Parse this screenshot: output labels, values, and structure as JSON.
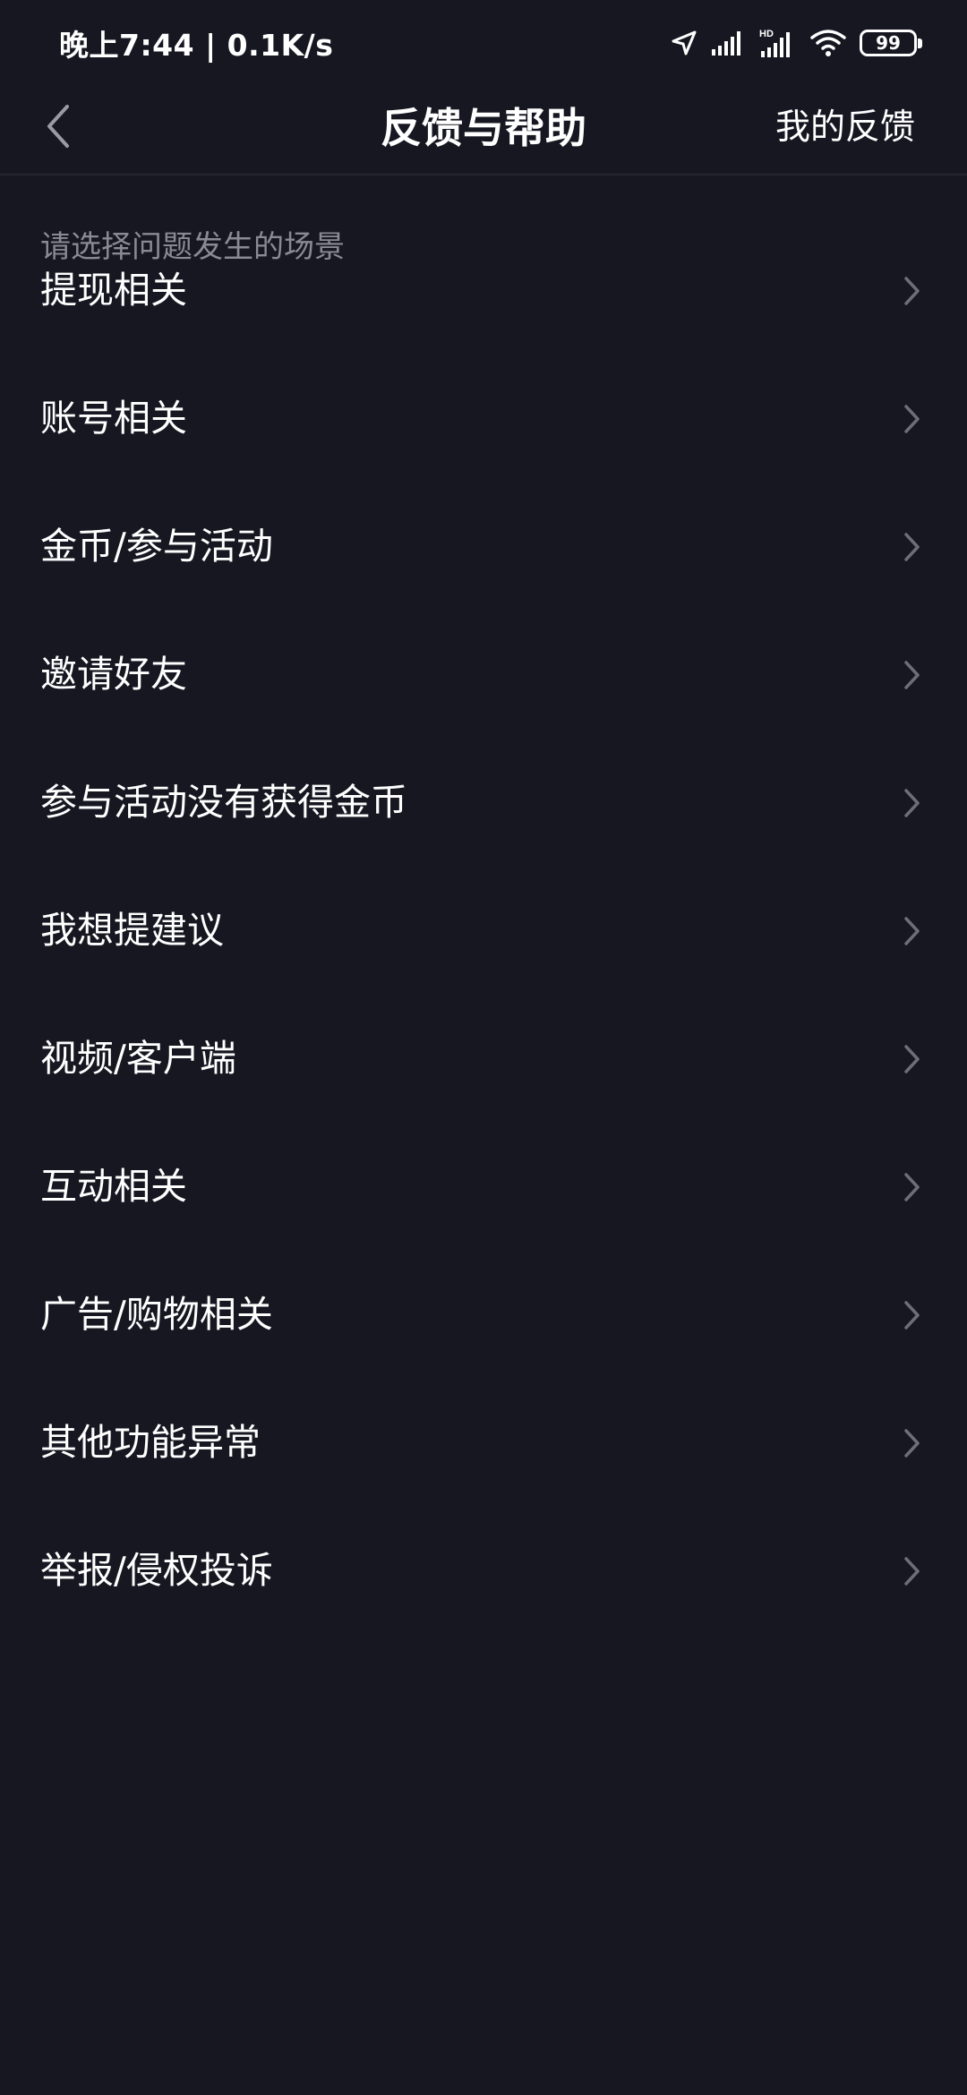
{
  "status_bar": {
    "time_speed": "晚上7:44 | 0.1K/s",
    "battery_level": "99",
    "icons": [
      "location-arrow-icon",
      "signal-icon",
      "hd-signal-icon",
      "wifi-icon",
      "battery-icon"
    ]
  },
  "nav": {
    "title": "反馈与帮助",
    "right_action": "我的反馈",
    "back_icon": "chevron-left-icon"
  },
  "hint": "请选择问题发生的场景",
  "items": [
    {
      "label": "提现相关"
    },
    {
      "label": "账号相关"
    },
    {
      "label": "金币/参与活动"
    },
    {
      "label": "邀请好友"
    },
    {
      "label": "参与活动没有获得金币"
    },
    {
      "label": "我想提建议"
    },
    {
      "label": "视频/客户端"
    },
    {
      "label": "互动相关"
    },
    {
      "label": "广告/购物相关"
    },
    {
      "label": "其他功能异常"
    },
    {
      "label": "举报/侵权投诉"
    }
  ],
  "colors": {
    "background": "#171722",
    "text": "#ffffff",
    "hint": "#8a8a93",
    "chevron": "#6e6e78",
    "divider": "#252532"
  }
}
